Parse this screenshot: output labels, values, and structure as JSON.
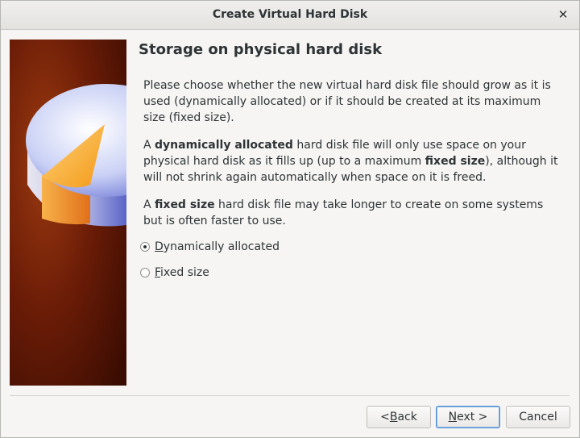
{
  "window": {
    "title": "Create Virtual Hard Disk",
    "close_glyph": "✕"
  },
  "content": {
    "heading": "Storage on physical hard disk",
    "para1": "Please choose whether the new virtual hard disk file should grow as it is used (dynamically allocated) or if it should be created at its maximum size (fixed size).",
    "para2": {
      "pre": "A ",
      "bold1": "dynamically allocated",
      "mid": " hard disk file will only use space on your physical hard disk as it fills up (up to a maximum ",
      "bold2": "fixed size",
      "post": "), although it will not shrink again automatically when space on it is freed."
    },
    "para3": {
      "pre": "A ",
      "bold1": "fixed size",
      "post": " hard disk file may take longer to create on some systems but is often faster to use."
    }
  },
  "options": [
    {
      "mnemonic": "D",
      "rest": "ynamically allocated",
      "checked": true
    },
    {
      "mnemonic": "F",
      "rest": "ixed size",
      "checked": false
    }
  ],
  "buttons": {
    "back": {
      "pre": "< ",
      "mnemonic": "B",
      "rest": "ack"
    },
    "next": {
      "mnemonic": "N",
      "rest": "ext >"
    },
    "cancel": "Cancel"
  },
  "icons": {
    "banner": "hard-disk-pie-illustration",
    "close": "close-icon"
  }
}
